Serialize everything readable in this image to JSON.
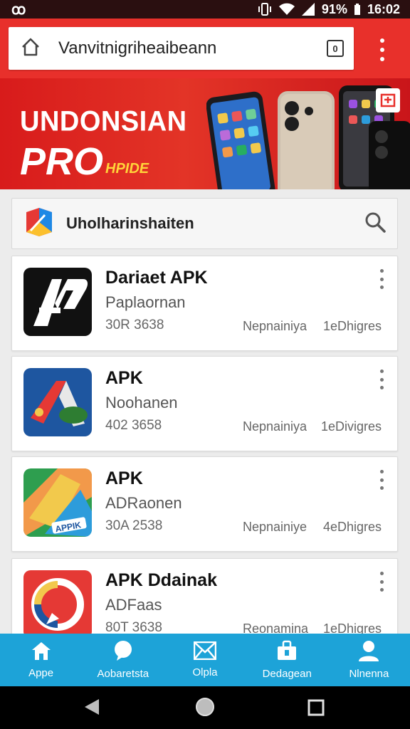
{
  "status_bar": {
    "left_glyph": "ꝏ",
    "battery": "91%",
    "time": "16:02",
    "icons": [
      "vibrate-icon",
      "wifi-icon",
      "signal-icon"
    ]
  },
  "browser": {
    "url": "Vanvitnigriheaibeann",
    "tab_count": "0",
    "accent_color": "#e8302b"
  },
  "banner": {
    "line1": "UNDONSIAN",
    "line2": "PRO",
    "tag": "HPIDE"
  },
  "search": {
    "text": "Uholharinshaiten",
    "icon": "search-icon"
  },
  "apps": [
    {
      "title": "Dariaet APK",
      "subtitle": "Paplaornan",
      "size": "30R 3638",
      "tag": "Nepnainiya",
      "rating": "1eDhigres"
    },
    {
      "title": "APK",
      "subtitle": "Noohanen",
      "size": "402 3658",
      "tag": "Nepnainiya",
      "rating": "1eDivigres"
    },
    {
      "title": "APK",
      "subtitle": "ADRaonen",
      "size": "30A 2538",
      "tag": "Nepnainiye",
      "rating": "4eDhigres",
      "icon_label": "APPIK"
    },
    {
      "title": "APK Ddainak",
      "subtitle": "ADFaas",
      "size": "80T 3638",
      "tag": "Reonamina",
      "rating": "1eDhigres"
    }
  ],
  "bottom_nav": {
    "color": "#1da3d8",
    "items": [
      {
        "label": "Appe",
        "icon": "home-icon"
      },
      {
        "label": "Aobaretsta",
        "icon": "chat-icon"
      },
      {
        "label": "Olpla",
        "icon": "mail-icon"
      },
      {
        "label": "Dedagean",
        "icon": "briefcase-icon"
      },
      {
        "label": "Nlnenna",
        "icon": "person-icon"
      }
    ]
  }
}
